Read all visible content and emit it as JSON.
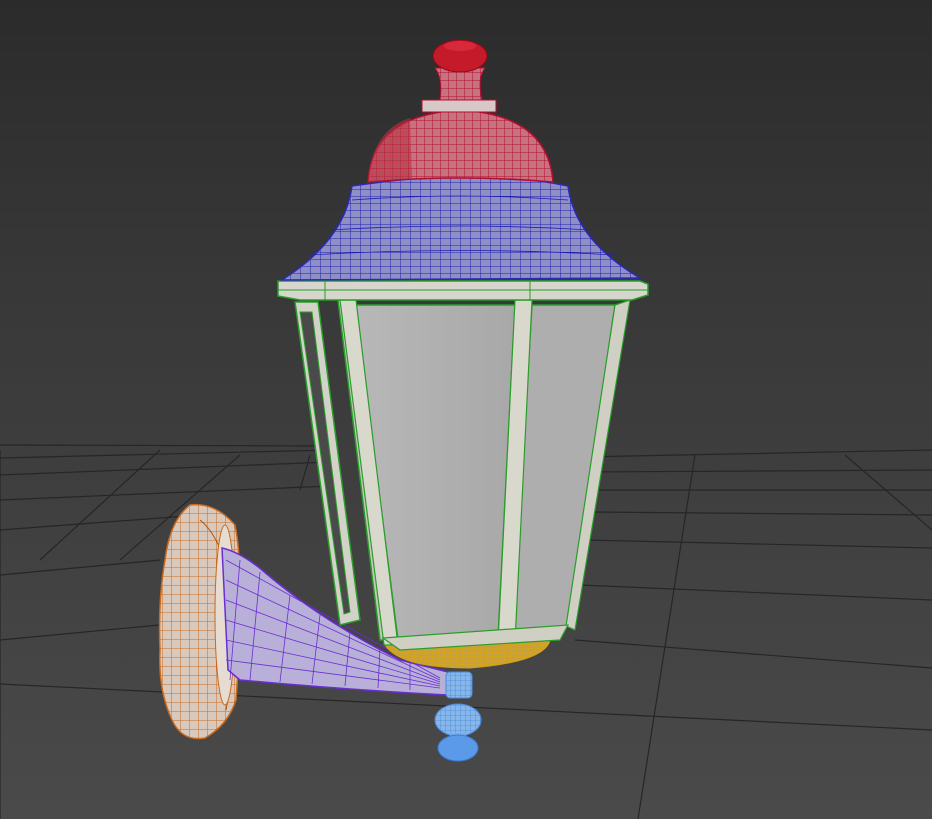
{
  "viewport": {
    "background_color": "#3a3a3a",
    "grid_color": "#262626",
    "mode": "shaded-with-wireframe-edges"
  },
  "scene": {
    "object": "lantern-wall-lamp",
    "parts": [
      {
        "name": "finial",
        "wire_color": "#c8102e"
      },
      {
        "name": "dome",
        "wire_color": "#c8102e"
      },
      {
        "name": "roof-canopy",
        "wire_color": "#2a2ab8"
      },
      {
        "name": "lantern-frame",
        "wire_color": "#2a9d2a"
      },
      {
        "name": "glass-panels",
        "wire_color": "#2a9d2a"
      },
      {
        "name": "bottom-cup",
        "wire_color": "#d4a017"
      },
      {
        "name": "bottom-knob",
        "wire_color": "#3a7bd5"
      },
      {
        "name": "wall-bracket-arm",
        "wire_color": "#6a2ed0"
      },
      {
        "name": "wall-plate",
        "wire_color": "#d07a2a"
      }
    ]
  }
}
